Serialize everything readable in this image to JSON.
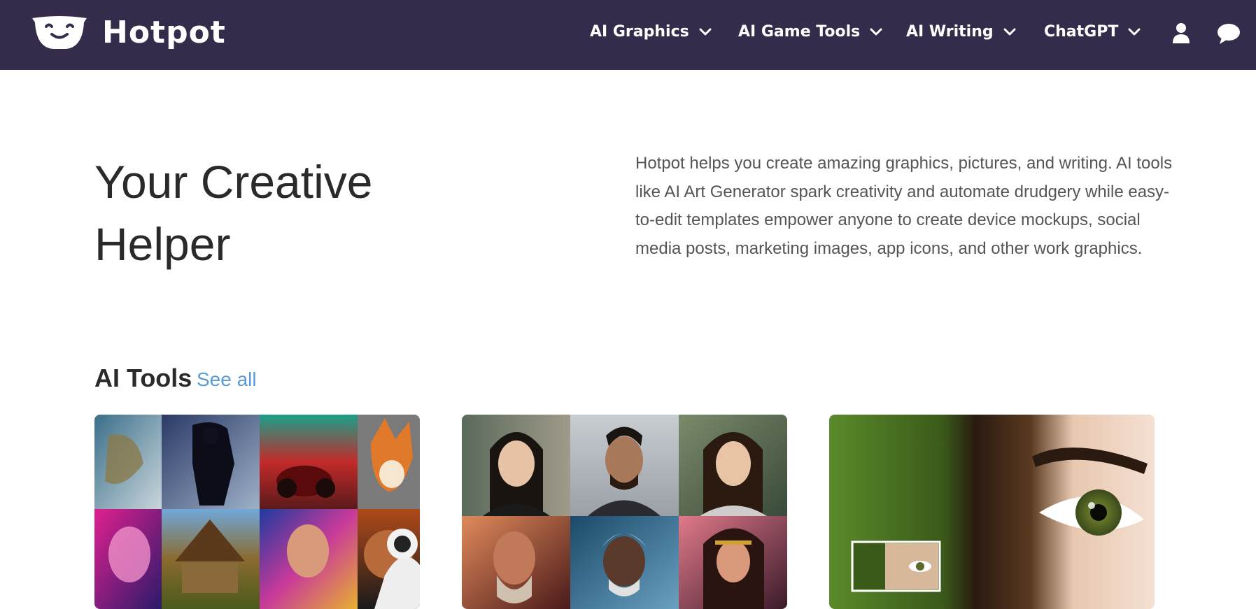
{
  "brand": {
    "name": "Hotpot"
  },
  "nav": {
    "items": [
      {
        "label": "AI Graphics"
      },
      {
        "label": "AI Game Tools"
      },
      {
        "label": "AI Writing"
      },
      {
        "label": "ChatGPT"
      }
    ],
    "icons": [
      "user-icon",
      "chat-bubble-icon",
      "chevron-down-icon"
    ]
  },
  "hero": {
    "title": "Your Creative Helper",
    "description": "Hotpot helps you create amazing graphics, pictures, and writing. AI tools like AI Art Generator spark creativity and automate drudgery while easy-to-edit templates empower anyone to create device mockups, social media posts, marketing images, app icons, and other work graphics."
  },
  "tools": {
    "heading": "AI Tools",
    "see_all_label": "See all"
  },
  "colors": {
    "header_bg": "#352b4a",
    "link": "#5b9bd5",
    "heading_text": "#2a2a2a",
    "body_text": "#555555"
  }
}
